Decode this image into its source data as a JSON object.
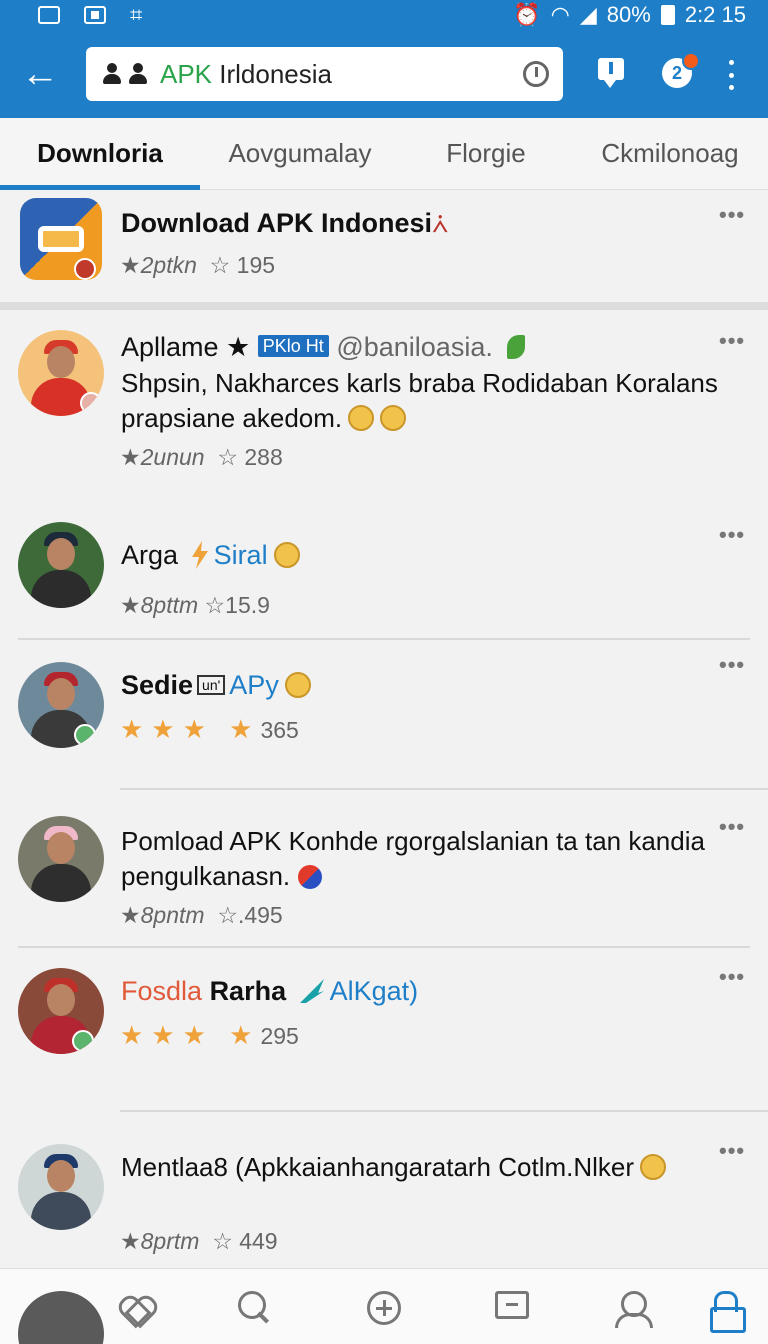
{
  "status_bar": {
    "battery": "80%",
    "time": "2:2 15"
  },
  "app_bar": {
    "back_icon": "arrow-left-icon",
    "search_prefix": "APK",
    "search_suffix": " Irldonesia",
    "notification_count": "2"
  },
  "tabs": [
    {
      "label": "Downloria",
      "active": true
    },
    {
      "label": "Aovgumalay",
      "active": false
    },
    {
      "label": "Florgie",
      "active": false
    },
    {
      "label": "Ckmilonoag",
      "active": false
    }
  ],
  "posts": [
    {
      "title": "Download APK Indonesi",
      "meta_a": "★2ptkn",
      "meta_b": "☆ 195",
      "more": "•••"
    },
    {
      "name": "Apllame ★",
      "tag": "PKlo Ht",
      "handle": "@baniloasia.",
      "text": "Shpsin, Nakharces karls braba Rodidaban Koralans prapsiane akedom.",
      "meta_a": "★2unun",
      "meta_b": "☆ 288",
      "more": "•••"
    },
    {
      "name": "Arga",
      "link": "Siral",
      "meta_a": "★8pttm",
      "meta_b": "☆15.9",
      "more": "•••"
    },
    {
      "name": "Sedie",
      "box": "un'",
      "link": "APy",
      "stars": "★★★  ★",
      "meta_b": "365",
      "more": "•••"
    },
    {
      "text": "Pomload APK Konhde rgorgalslanian ta tan kandia pengulkanasn.",
      "meta_a": "★8pntm",
      "meta_b": "☆.495",
      "more": "•••"
    },
    {
      "name_red": "Fosdla",
      "name": "Rarha",
      "link": "AlKgat)",
      "stars": "★★★  ★",
      "meta_b": "295",
      "more": "•••"
    },
    {
      "text": "Mentlaa8 (Apkkaianhangaratarh Cotlm.Nlker",
      "meta_a": "★8prtm",
      "meta_b": "☆ 449",
      "more": "•••"
    }
  ],
  "colors": {
    "accent": "#1e7fc8",
    "star": "#f0a23a",
    "verified_green": "#2aa34a"
  }
}
